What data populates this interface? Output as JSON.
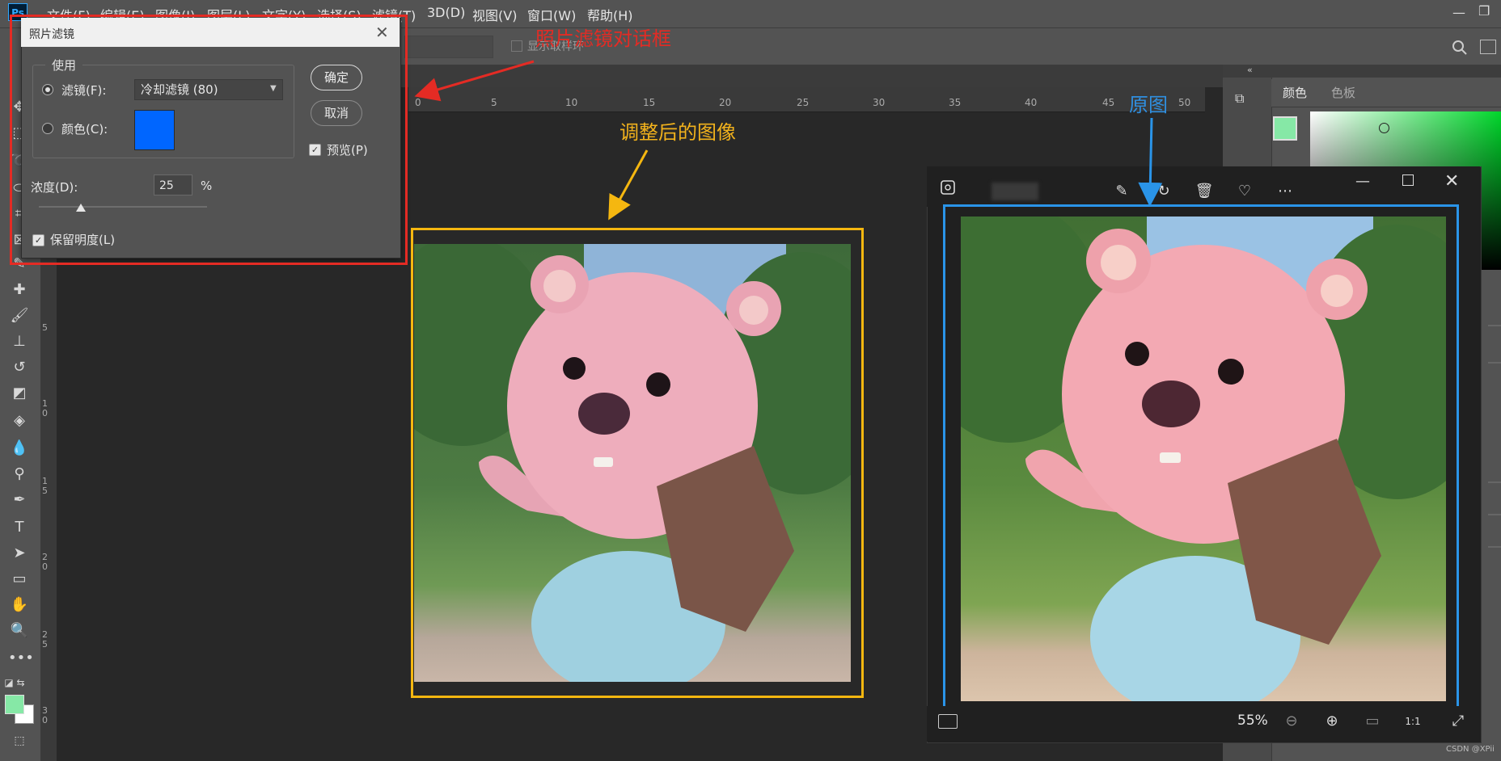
{
  "menubar": {
    "logo": "Ps",
    "items": [
      "文件(F)",
      "编辑(E)",
      "图像(I)",
      "图层(L)",
      "文字(Y)",
      "选择(S)",
      "滤镜(T)",
      "3D(D)",
      "视图(V)",
      "窗口(W)",
      "帮助(H)"
    ]
  },
  "optionsbar": {
    "show_sampling_ring": "显示取样环"
  },
  "rulers": {
    "horizontal": [
      "0",
      "5",
      "10",
      "15",
      "20",
      "25",
      "30",
      "35",
      "40",
      "45",
      "50"
    ],
    "vertical": [
      "5",
      "1\n0",
      "1\n5",
      "2\n0",
      "2\n5",
      "3\n0"
    ]
  },
  "dialog": {
    "title": "照片滤镜",
    "group_label": "使用",
    "filter_label": "滤镜(F):",
    "filter_value": "冷却滤镜 (80)",
    "color_label": "颜色(C):",
    "color_value": "#0066ff",
    "ok": "确定",
    "cancel": "取消",
    "preview_label": "预览(P)",
    "preview_checked": true,
    "density_label": "浓度(D):",
    "density_value": "25",
    "density_unit": "%",
    "density_fraction": 0.25,
    "preserve_luminosity_label": "保留明度(L)",
    "preserve_luminosity_checked": true
  },
  "annotations": {
    "dialog": "照片滤镜对话框",
    "adjusted": "调整后的图像",
    "original": "原图"
  },
  "right_panel": {
    "tabs": [
      "颜色",
      "色板"
    ],
    "foreground_color": "#86e8a6",
    "background_color": "#ffffff"
  },
  "viewer": {
    "zoom": "55%",
    "toolbar_icons": [
      "edit-image-icon",
      "rotate-icon",
      "delete-icon",
      "favorite-icon",
      "more-icon"
    ],
    "status_icons": [
      "zoom-out-icon",
      "zoom-in-icon",
      "fit-icon",
      "actual-size-icon",
      "fullscreen-icon"
    ],
    "actual_size_label": "1:1"
  },
  "watermark": "CSDN @XPii",
  "colors": {
    "annotation_red": "#e42b24",
    "annotation_yellow": "#f5b710",
    "annotation_blue": "#2a94e8"
  }
}
